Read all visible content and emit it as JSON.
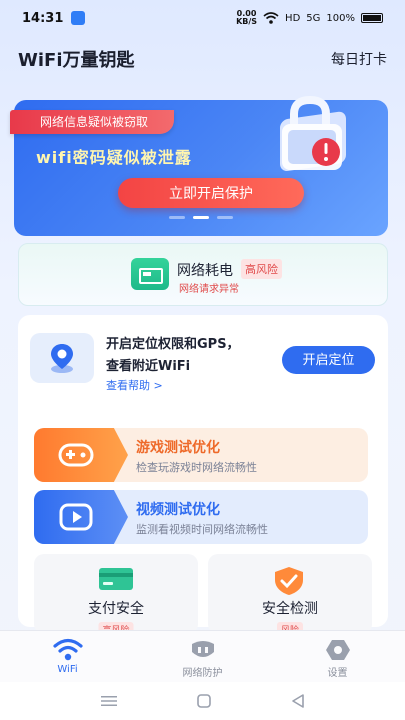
{
  "status_bar": {
    "time": "14:31",
    "speed_value": "0.00",
    "speed_unit": "KB/S",
    "network": "HD",
    "signal": "5G",
    "battery": "100%"
  },
  "header": {
    "title": "WiFi万量钥匙",
    "checkin_label": "每日打卡"
  },
  "banner": {
    "ribbon_text": "网络信息疑似被窃取",
    "headline": "wifi密码疑似被泄露",
    "button_label": "立即开启保护",
    "active_slide": 2,
    "slide_count": 3
  },
  "alert": {
    "title": "网络耗电",
    "badge": "高风险",
    "subtitle": "网络请求异常"
  },
  "location": {
    "line1": "开启定位权限和GPS，",
    "line2": "查看附近WiFi",
    "help": "查看帮助 >",
    "button_label": "开启定位"
  },
  "optimize": [
    {
      "title": "游戏测试优化",
      "subtitle": "检查玩游戏时网络流畅性",
      "icon": "gamepad-icon"
    },
    {
      "title": "视频测试优化",
      "subtitle": "监测看视频时间网络流畅性",
      "icon": "play-icon"
    }
  ],
  "tiles": [
    {
      "title": "支付安全",
      "badge": "高风险",
      "icon": "card-icon"
    },
    {
      "title": "安全检测",
      "badge": "风险",
      "icon": "shield-check-icon"
    }
  ],
  "bottom_nav": [
    {
      "label": "WiFi",
      "icon": "wifi-icon",
      "active": true
    },
    {
      "label": "网络防护",
      "icon": "shield-icon",
      "active": false
    },
    {
      "label": "设置",
      "icon": "settings-icon",
      "active": false
    }
  ],
  "colors": {
    "primary": "#2f6cf0",
    "danger": "#e04a4a",
    "orange": "#ee6a2a",
    "green": "#1fb98a"
  }
}
